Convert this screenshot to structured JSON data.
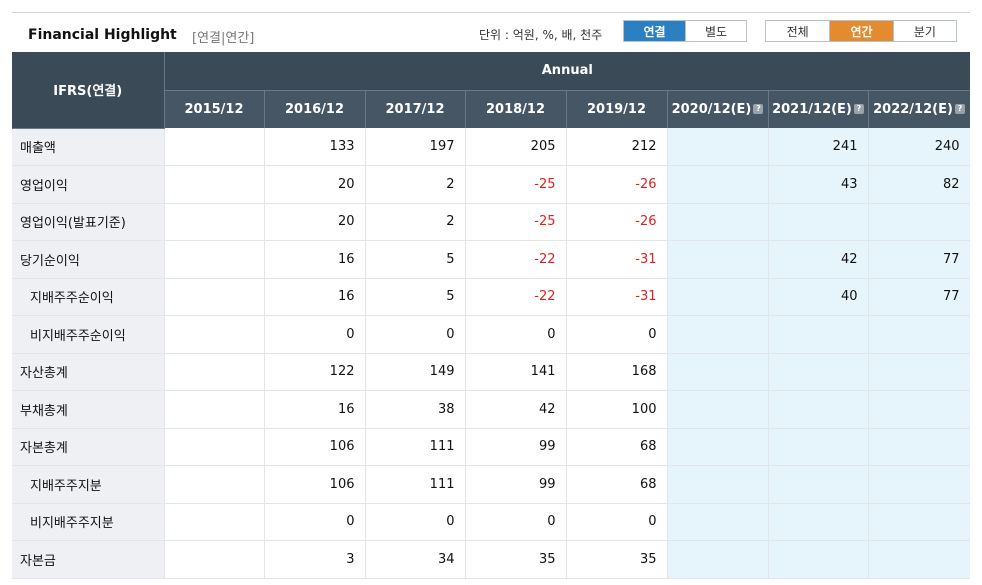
{
  "header": {
    "title": "Financial Highlight",
    "subtitle": "[연결|연간]",
    "unit": "단위 : 억원, %, 배, 천주",
    "scope_tabs": [
      {
        "label": "연결",
        "active": true
      },
      {
        "label": "별도",
        "active": false
      }
    ],
    "period_tabs": [
      {
        "label": "전체",
        "active": false
      },
      {
        "label": "연간",
        "active": true
      },
      {
        "label": "분기",
        "active": false
      }
    ]
  },
  "table": {
    "corner_label": "IFRS(연결)",
    "group_label": "Annual",
    "columns": [
      "2015/12",
      "2016/12",
      "2017/12",
      "2018/12",
      "2019/12",
      "2020/12(E)",
      "2021/12(E)",
      "2022/12(E)"
    ],
    "estimate_icon": "?",
    "rows": [
      {
        "label": "매출액",
        "indent": false,
        "values": [
          "",
          "133",
          "197",
          "205",
          "212",
          "",
          "241",
          "240"
        ]
      },
      {
        "label": "영업이익",
        "indent": false,
        "values": [
          "",
          "20",
          "2",
          "-25",
          "-26",
          "",
          "43",
          "82"
        ]
      },
      {
        "label": "영업이익(발표기준)",
        "indent": false,
        "values": [
          "",
          "20",
          "2",
          "-25",
          "-26",
          "",
          "",
          ""
        ]
      },
      {
        "label": "당기순이익",
        "indent": false,
        "values": [
          "",
          "16",
          "5",
          "-22",
          "-31",
          "",
          "42",
          "77"
        ]
      },
      {
        "label": "지배주주순이익",
        "indent": true,
        "values": [
          "",
          "16",
          "5",
          "-22",
          "-31",
          "",
          "40",
          "77"
        ]
      },
      {
        "label": "비지배주주순이익",
        "indent": true,
        "values": [
          "",
          "0",
          "0",
          "0",
          "0",
          "",
          "",
          ""
        ]
      },
      {
        "label": "자산총계",
        "indent": false,
        "values": [
          "",
          "122",
          "149",
          "141",
          "168",
          "",
          "",
          ""
        ]
      },
      {
        "label": "부채총계",
        "indent": false,
        "values": [
          "",
          "16",
          "38",
          "42",
          "100",
          "",
          "",
          ""
        ]
      },
      {
        "label": "자본총계",
        "indent": false,
        "values": [
          "",
          "106",
          "111",
          "99",
          "68",
          "",
          "",
          ""
        ]
      },
      {
        "label": "지배주주지분",
        "indent": true,
        "values": [
          "",
          "106",
          "111",
          "99",
          "68",
          "",
          "",
          ""
        ]
      },
      {
        "label": "비지배주주지분",
        "indent": true,
        "values": [
          "",
          "0",
          "0",
          "0",
          "0",
          "",
          "",
          ""
        ]
      },
      {
        "label": "자본금",
        "indent": false,
        "values": [
          "",
          "3",
          "34",
          "35",
          "35",
          "",
          "",
          ""
        ]
      }
    ]
  },
  "colors": {
    "negative": "#e21f1f",
    "estimate_bg": "#e6f5fb",
    "header_bg": "#3b4a57",
    "active_scope": "#2b7fc3",
    "active_period": "#e38b2e"
  }
}
